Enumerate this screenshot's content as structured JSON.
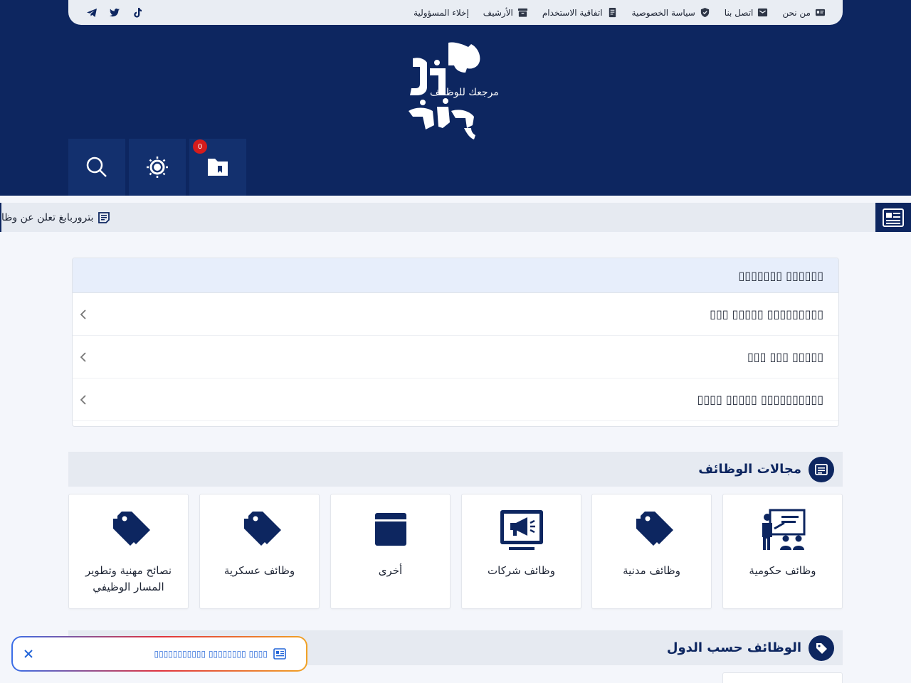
{
  "topbar": {
    "links": [
      {
        "label": "من نحن",
        "icon": "id-card-icon"
      },
      {
        "label": "اتصل بنا",
        "icon": "envelope-icon"
      },
      {
        "label": "سياسة الخصوصية",
        "icon": "shield-icon"
      },
      {
        "label": "اتفاقية الاستخدام",
        "icon": "document-icon"
      },
      {
        "label": "الأرشيف",
        "icon": "archive-icon"
      },
      {
        "label": "إخلاء المسؤولية",
        "icon": ""
      }
    ],
    "social": [
      "tiktok-icon",
      "twitter-icon",
      "telegram-icon"
    ]
  },
  "logo": {
    "name": "نحن نوظف",
    "tagline": "مرجعك للوظائف"
  },
  "header_buttons": {
    "bookmarks_count": "0"
  },
  "ticker": {
    "item": "بتروربابغ تعلن عن وظا"
  },
  "toc": {
    "title": "▯▯▯▯▯▯▯ ▯▯▯▯▯▯",
    "items": [
      "▯▯▯ ▯▯▯▯▯ ▯▯▯▯▯▯▯▯▯",
      "▯▯▯ ▯▯▯ ▯▯▯▯▯",
      "▯▯▯▯ ▯▯▯▯▯ ▯▯▯▯▯▯▯▯▯▯"
    ]
  },
  "section_fields": {
    "title": "مجالات الوظائف"
  },
  "cards": [
    {
      "label": "وظائف حكومية",
      "icon": "teacher-board-icon"
    },
    {
      "label": "وظائف مدنية",
      "icon": "tags-icon"
    },
    {
      "label": "وظائف شركات",
      "icon": "megaphone-screen-icon"
    },
    {
      "label": "أخرى",
      "icon": "window-icon"
    },
    {
      "label": "وظائف عسكرية",
      "icon": "tags-icon"
    },
    {
      "label": "نصائح مهنية وتطوير المسار الوظيفي",
      "icon": "tags-icon"
    }
  ],
  "section_countries": {
    "title": "الوظائف حسب الدول"
  },
  "floating_notice": {
    "text": "▯▯▯▯ ▯▯▯▯▯▯▯▯ ▯▯▯▯▯▯▯▯▯▯▯"
  },
  "colors": {
    "brand_navy": "#0d2660",
    "badge_red": "#d51c1c",
    "link_blue": "#2466d9"
  }
}
